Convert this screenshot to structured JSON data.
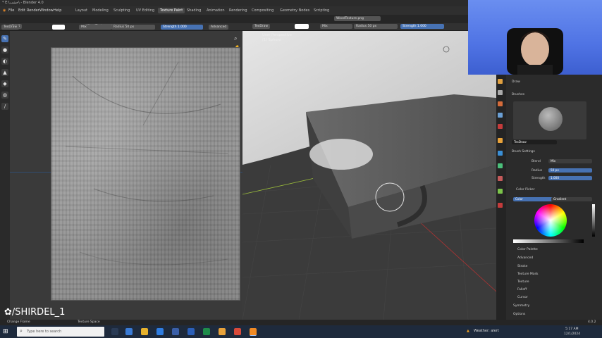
{
  "window": {
    "title": "* E:\\خشب\\ - Blender 4.0"
  },
  "menu": [
    "File",
    "Edit",
    "Render",
    "Window",
    "Help"
  ],
  "workspaces": [
    "Layout",
    "Modeling",
    "Sculpting",
    "UV Editing",
    "Texture Paint",
    "Shading",
    "Animation",
    "Rendering",
    "Compositing",
    "Geometry Nodes",
    "Scripting"
  ],
  "active_workspace": "Texture Paint",
  "left_header": {
    "mode": "Paint",
    "image": "WoodTexture.png",
    "brush": "TexDraw",
    "blend": "Mix",
    "radius_label": "Radius",
    "radius_value": "50 px",
    "strength_label": "Strength",
    "strength_value": "1.000",
    "advanced": "Advanced"
  },
  "view_header": {
    "brush": "TexDraw",
    "blend": "Mix",
    "radius_label": "Radius",
    "radius_value": "50 px",
    "strength_label": "Strength",
    "strength_value": "1.000",
    "image": "WoodTexture.png"
  },
  "viewport": {
    "overlay_line1": "User Perspective",
    "overlay_line2": "(1) Sphere"
  },
  "properties": {
    "tool_name": "Draw",
    "brushes_header": "Brushes",
    "brush_name": "TexDraw",
    "brush_settings_header": "Brush Settings",
    "blend_label": "Blend",
    "blend_value": "Mix",
    "radius_label": "Radius",
    "radius_value": "50 px",
    "strength_label": "Strength",
    "strength_value": "1.000",
    "color_picker_header": "Color Picker",
    "color_tab": "Color",
    "gradient_tab": "Gradient",
    "sections": [
      "Color Palette",
      "Advanced",
      "Stroke",
      "Texture Mask",
      "Texture",
      "Falloff",
      "Cursor",
      "Symmetry",
      "Options"
    ]
  },
  "watermark": "/SHIRDEL_1",
  "status": {
    "left": "Change Frame",
    "mid": "Texture Space",
    "right": "4.0.2"
  },
  "taskbar": {
    "search_placeholder": "Type here to search",
    "weather": "Weather: alert",
    "time": "5:17 AM",
    "date": "12/1/2024"
  },
  "colors": {
    "accent": "#4772b3",
    "webcam_bg": "#5b7ff0"
  }
}
